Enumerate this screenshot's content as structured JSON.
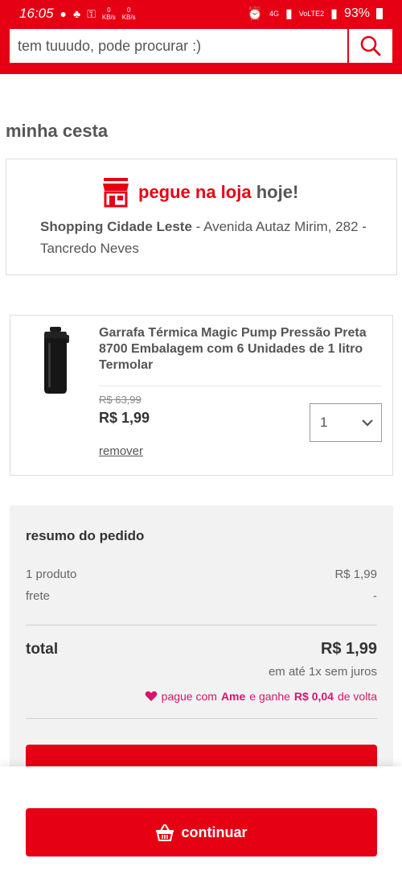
{
  "status_bar": {
    "time": "16:05",
    "net_up": "0",
    "net_unit": "KB/s",
    "net_down": "0",
    "signal_1": "4G",
    "signal_2": "VoLTE2",
    "battery": "93%"
  },
  "search": {
    "placeholder": "tem tuuudo, pode procurar :)"
  },
  "page": {
    "title": "minha cesta"
  },
  "store": {
    "pickup_label": "pegue na loja",
    "pickup_suffix": "hoje!",
    "store_name": "Shopping Cidade Leste",
    "address": " - Avenida Autaz Mirim, 282 - Tancredo Neves"
  },
  "product": {
    "name": "Garrafa Térmica Magic Pump Pressão Preta 8700 Embalagem com 6 Unidades de 1 litro Termolar",
    "old_price": "R$ 63,99",
    "price": "R$ 1,99",
    "quantity": "1",
    "remove_label": "remover"
  },
  "summary": {
    "title": "resumo do pedido",
    "items_label": "1 produto",
    "items_value": "R$ 1,99",
    "shipping_label": "frete",
    "shipping_value": "-",
    "total_label": "total",
    "total_value": "R$ 1,99",
    "installments": "em até 1x sem juros",
    "ame_prefix": "pague com",
    "ame_brand": "Ame",
    "ame_middle": "e ganhe",
    "ame_cashback": "R$ 0,04",
    "ame_suffix": "de volta"
  },
  "actions": {
    "continue_label": "continuar"
  },
  "colors": {
    "brand_red": "#e60014",
    "ame_pink": "#d6156e"
  }
}
